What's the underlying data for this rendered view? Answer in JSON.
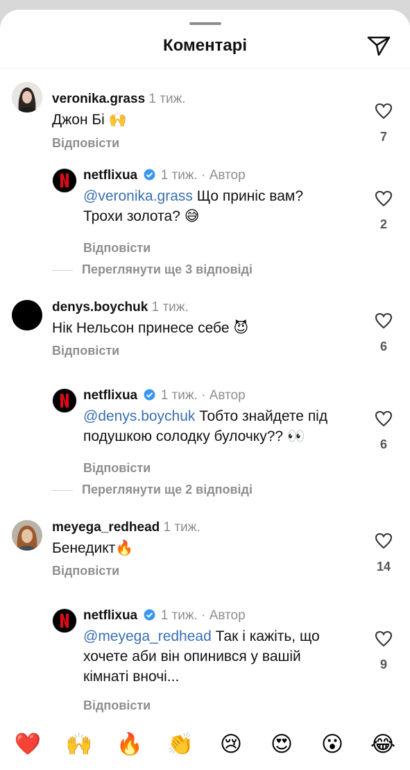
{
  "header": {
    "title": "Коментарі",
    "send_icon": "paper-plane-icon"
  },
  "meta_time": "1 тиж.",
  "author_label": "Автор",
  "reply_label": "Відповісти",
  "threads": [
    {
      "comment": {
        "username": "veronika.grass",
        "time": "1 тиж.",
        "text": "Джон Бі",
        "emoji": "🙌",
        "likes": "7"
      },
      "reply": {
        "username": "netflixua",
        "time": "1 тиж. · Автор",
        "mention": "@veronika.grass",
        "text_line1": " Що приніс вам?",
        "text_line2": "Трохи золота? 😅",
        "likes": "2"
      },
      "more": "Переглянути ще 3 відповіді"
    },
    {
      "comment": {
        "username": "denys.boychuk",
        "time": "1 тиж.",
        "text": "Нік Нельсон принесе себе",
        "emoji": "😈",
        "likes": "6"
      },
      "reply": {
        "username": "netflixua",
        "time": "1 тиж. · Автор",
        "mention": "@denys.boychuk",
        "text_line1": " Тобто знайдете під",
        "text_line2": "подушкою солодку булочку?? 👀",
        "likes": "6"
      },
      "more": "Переглянути ще 2 відповіді"
    },
    {
      "comment": {
        "username": "meyega_redhead",
        "time": "1 тиж.",
        "text": "Бенедикт",
        "emoji": "🔥",
        "likes": "14"
      },
      "reply": {
        "username": "netflixua",
        "time": "1 тиж. · Автор",
        "mention": "@meyega_redhead",
        "text_line1": " Так і кажіть, що",
        "text_line2": "хочете аби він опинився у вашій",
        "text_line3": "кімнаті вночі...",
        "likes": "9"
      }
    }
  ],
  "emoji_bar": [
    "❤️",
    "🙌",
    "🔥",
    "👏",
    "😢",
    "😍",
    "😮",
    "😂"
  ],
  "colors": {
    "mention": "#3a6fb0",
    "netflix_red": "#e50914",
    "verified": "#3897f0"
  }
}
